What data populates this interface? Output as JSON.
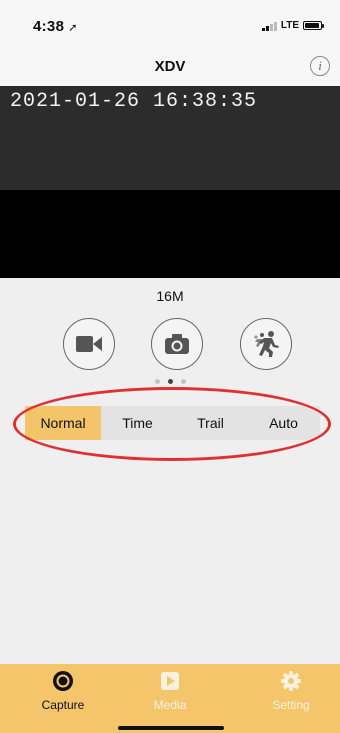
{
  "status_bar": {
    "time": "4:38",
    "location_icon": "location-arrow-icon",
    "network": "LTE"
  },
  "nav": {
    "title": "XDV",
    "info_icon": "info-icon",
    "info_glyph": "i"
  },
  "preview": {
    "timestamp": "2021-01-26 16:38:35"
  },
  "capture": {
    "resolution": "16M",
    "mode_buttons": [
      {
        "name": "video-mode-button",
        "icon": "video-camera-icon"
      },
      {
        "name": "photo-mode-button",
        "icon": "camera-icon"
      },
      {
        "name": "burst-mode-button",
        "icon": "running-person-icon"
      }
    ],
    "page_dots": {
      "count": 3,
      "active_index": 1
    },
    "shot_modes": [
      "Normal",
      "Time",
      "Trail",
      "Auto"
    ],
    "selected_shot_mode": "Normal"
  },
  "annotation": {
    "color": "#e03030"
  },
  "tabs": [
    {
      "label": "Capture",
      "icon": "capture-icon",
      "active": true
    },
    {
      "label": "Media",
      "icon": "play-icon",
      "active": false
    },
    {
      "label": "Setting",
      "icon": "gear-icon",
      "active": false
    }
  ],
  "colors": {
    "accent": "#f5c56b",
    "selected_segment": "#f3c46a",
    "inactive_tab_text": "#fbf2de"
  }
}
